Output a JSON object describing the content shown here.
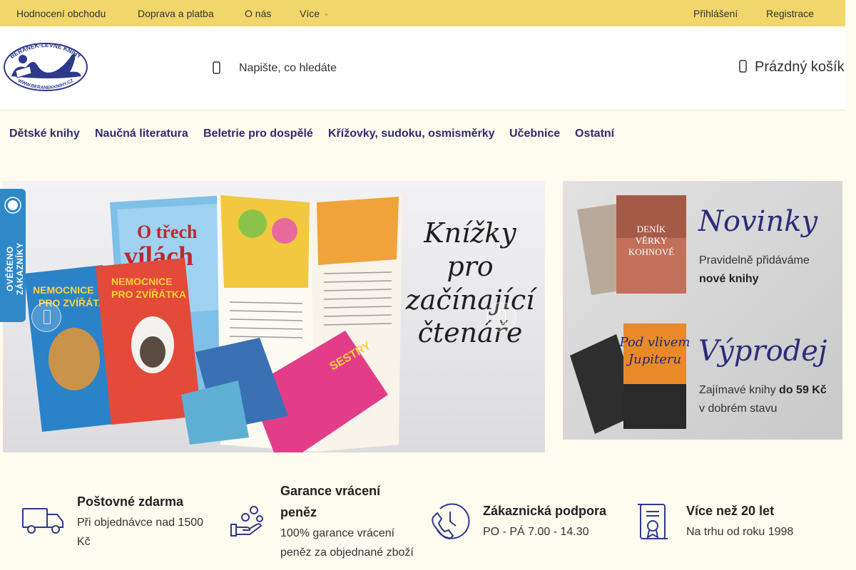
{
  "topbar": {
    "links": [
      "Hodnocení obchodu",
      "Doprava a platba",
      "O nás",
      "Více"
    ],
    "login": "Přihlášení",
    "register": "Registrace"
  },
  "header": {
    "logo_text_top": "BERÁNEK-LEVNÉ KNIHY",
    "logo_text_bottom": "WWW.BERANEKKNIHY.CZ",
    "search_placeholder": "Napište, co hledáte",
    "cart_label": "Prázdný košík"
  },
  "nav": {
    "items": [
      "Dětské knihy",
      "Naučná literatura",
      "Beletrie pro dospělé",
      "Křížovky, sudoku, osmisměrky",
      "Učebnice",
      "Ostatní"
    ]
  },
  "hero": {
    "line1": "Knížky",
    "line2": "pro",
    "line3": "začínající",
    "line4": "čtenáře"
  },
  "side_banner": {
    "novinky_title": "Novinky",
    "novinky_text1": "Pravidelně přidáváme",
    "novinky_text2": "nové knihy",
    "vyprodej_title": "Výprodej",
    "vyprodej_text1": "Zajímavé knihy ",
    "vyprodej_bold": "do 59 Kč",
    "vyprodej_text2": "v dobrém stavu"
  },
  "badge": {
    "text": "OVĚŘENO ZÁKAZNÍKY"
  },
  "features": [
    {
      "title": "Poštovné zdarma",
      "desc1": "Při objednávce nad 1500",
      "desc2": "Kč",
      "icon": "truck-icon"
    },
    {
      "title1": "Garance vrácení",
      "title2": "peněz",
      "desc1": "100% garance vrácení",
      "desc2": "peněz za objednané zboží",
      "icon": "money-hand-icon"
    },
    {
      "title": "Zákaznická podpora",
      "desc1": "PO - PÁ 7.00 - 14.30",
      "icon": "clock-phone-icon"
    },
    {
      "title": "Více než 20 let",
      "desc1": "Na trhu od roku 1998",
      "icon": "certificate-icon"
    }
  ],
  "colors": {
    "topbar": "#f1d66b",
    "background": "#fefbef",
    "nav_text": "#2e2c6e",
    "icon_blue": "#2d3a8c",
    "badge": "#2f88c8"
  }
}
